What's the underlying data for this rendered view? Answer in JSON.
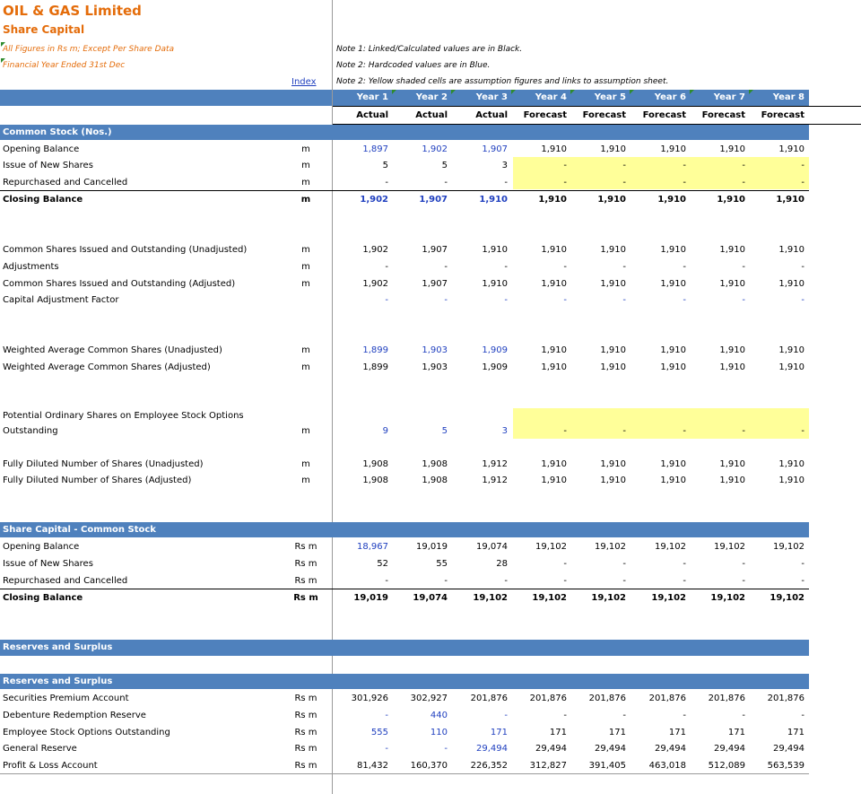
{
  "header": {
    "company": "OIL & GAS Limited",
    "sheet": "Share Capital",
    "units_note": "All Figures in Rs m; Except Per Share Data",
    "fy_note": "Financial Year Ended 31st Dec",
    "index_link": "Index",
    "notes": [
      "Note 1: Linked/Calculated values are in Black.",
      "Note 2: Hardcoded values are in Blue.",
      "Note 2: Yellow shaded cells are assumption figures and links to assumption sheet."
    ]
  },
  "columns": {
    "years": [
      "Year 1",
      "Year 2",
      "Year 3",
      "Year 4",
      "Year 5",
      "Year 6",
      "Year 7",
      "Year 8"
    ],
    "types": [
      "Actual",
      "Actual",
      "Actual",
      "Forecast",
      "Forecast",
      "Forecast",
      "Forecast",
      "Forecast"
    ]
  },
  "colors": {
    "band": "#4f81bd",
    "accent": "#e46c0a",
    "hardcoded": "#1f3fbf",
    "assumption": "#ffff99"
  },
  "sections": {
    "common_stock": "Common Stock (Nos.)",
    "share_capital": "Share Capital - Common Stock",
    "reserves_header": "Reserves and Surplus",
    "reserves": "Reserves and Surplus"
  },
  "rows": {
    "opening": {
      "label": "Opening Balance",
      "unit": "m",
      "values": [
        "1,897",
        "1,902",
        "1,907",
        "1,910",
        "1,910",
        "1,910",
        "1,910",
        "1,910"
      ]
    },
    "issue": {
      "label": "Issue of New Shares",
      "unit": "m",
      "values": [
        "5",
        "5",
        "3",
        "-",
        "-",
        "-",
        "-",
        "-"
      ]
    },
    "repurchased": {
      "label": "Repurchased and Cancelled",
      "unit": "m",
      "values": [
        "-",
        "-",
        "-",
        "-",
        "-",
        "-",
        "-",
        "-"
      ]
    },
    "closing": {
      "label": "Closing Balance",
      "unit": "m",
      "values": [
        "1,902",
        "1,907",
        "1,910",
        "1,910",
        "1,910",
        "1,910",
        "1,910",
        "1,910"
      ]
    },
    "unadj": {
      "label": "Common Shares Issued and Outstanding (Unadjusted)",
      "unit": "m",
      "values": [
        "1,902",
        "1,907",
        "1,910",
        "1,910",
        "1,910",
        "1,910",
        "1,910",
        "1,910"
      ]
    },
    "adjustments": {
      "label": "Adjustments",
      "unit": "m",
      "values": [
        "-",
        "-",
        "-",
        "-",
        "-",
        "-",
        "-",
        "-"
      ]
    },
    "adj": {
      "label": "Common Shares Issued and Outstanding (Adjusted)",
      "unit": "m",
      "values": [
        "1,902",
        "1,907",
        "1,910",
        "1,910",
        "1,910",
        "1,910",
        "1,910",
        "1,910"
      ]
    },
    "factor": {
      "label": "Capital Adjustment Factor",
      "unit": "",
      "values": [
        "-",
        "-",
        "-",
        "-",
        "-",
        "-",
        "-",
        "-"
      ]
    },
    "wavg_unadj": {
      "label": "Weighted Average Common Shares (Unadjusted)",
      "unit": "m",
      "values": [
        "1,899",
        "1,903",
        "1,909",
        "1,910",
        "1,910",
        "1,910",
        "1,910",
        "1,910"
      ]
    },
    "wavg_adj": {
      "label": "Weighted Average Common Shares (Adjusted)",
      "unit": "m",
      "values": [
        "1,899",
        "1,903",
        "1,909",
        "1,910",
        "1,910",
        "1,910",
        "1,910",
        "1,910"
      ]
    },
    "esop_line1": "Potential Ordinary Shares on Employee Stock Options",
    "esop": {
      "label": "Outstanding",
      "unit": "m",
      "values": [
        "9",
        "5",
        "3",
        "-",
        "-",
        "-",
        "-",
        "-"
      ]
    },
    "fd_unadj": {
      "label": "Fully Diluted Number of Shares (Unadjusted)",
      "unit": "m",
      "values": [
        "1,908",
        "1,908",
        "1,912",
        "1,910",
        "1,910",
        "1,910",
        "1,910",
        "1,910"
      ]
    },
    "fd_adj": {
      "label": "Fully Diluted Number of Shares (Adjusted)",
      "unit": "m",
      "values": [
        "1,908",
        "1,908",
        "1,912",
        "1,910",
        "1,910",
        "1,910",
        "1,910",
        "1,910"
      ]
    },
    "sc_opening": {
      "label": "Opening Balance",
      "unit": "Rs m",
      "values": [
        "18,967",
        "19,019",
        "19,074",
        "19,102",
        "19,102",
        "19,102",
        "19,102",
        "19,102"
      ]
    },
    "sc_issue": {
      "label": "Issue of New Shares",
      "unit": "Rs m",
      "values": [
        "52",
        "55",
        "28",
        "-",
        "-",
        "-",
        "-",
        "-"
      ]
    },
    "sc_repurchased": {
      "label": "Repurchased and Cancelled",
      "unit": "Rs m",
      "values": [
        "-",
        "-",
        "-",
        "-",
        "-",
        "-",
        "-",
        "-"
      ]
    },
    "sc_closing": {
      "label": "Closing Balance",
      "unit": "Rs m",
      "values": [
        "19,019",
        "19,074",
        "19,102",
        "19,102",
        "19,102",
        "19,102",
        "19,102",
        "19,102"
      ]
    },
    "securities": {
      "label": "Securities Premium Account",
      "unit": "Rs m",
      "values": [
        "301,926",
        "302,927",
        "201,876",
        "201,876",
        "201,876",
        "201,876",
        "201,876",
        "201,876"
      ]
    },
    "debenture": {
      "label": "Debenture Redemption Reserve",
      "unit": "Rs m",
      "values": [
        "-",
        "440",
        "-",
        "-",
        "-",
        "-",
        "-",
        "-"
      ]
    },
    "esop_out": {
      "label": "Employee Stock Options Outstanding",
      "unit": "Rs m",
      "values": [
        "555",
        "110",
        "171",
        "171",
        "171",
        "171",
        "171",
        "171"
      ]
    },
    "general": {
      "label": "General Reserve",
      "unit": "Rs m",
      "values": [
        "-",
        "-",
        "29,494",
        "29,494",
        "29,494",
        "29,494",
        "29,494",
        "29,494"
      ]
    },
    "pnl": {
      "label": "Profit & Loss Account",
      "unit": "Rs m",
      "values": [
        "81,432",
        "160,370",
        "226,352",
        "312,827",
        "391,405",
        "463,018",
        "512,089",
        "563,539"
      ]
    }
  }
}
